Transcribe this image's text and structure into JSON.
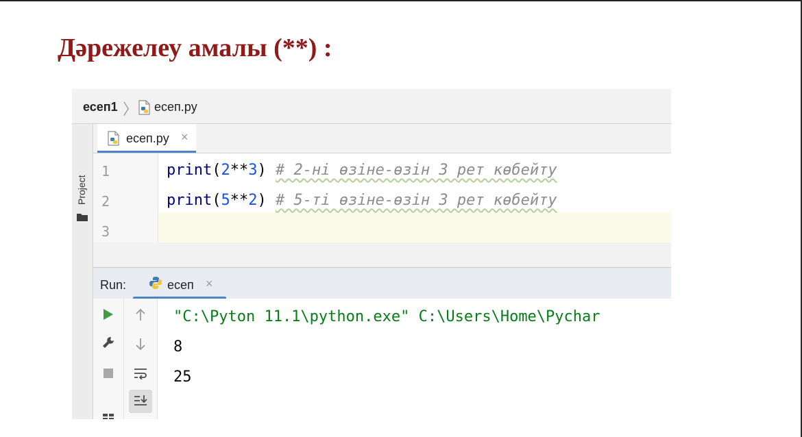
{
  "slide": {
    "title": "Дәрежелеу амалы (**) :"
  },
  "breadcrumb": {
    "project": "есеп1",
    "separator": "〉",
    "file": "есеп.py"
  },
  "sidebar": {
    "project_label": "Project"
  },
  "tabs": [
    {
      "label": "есеп.py",
      "close": "×"
    }
  ],
  "editor": {
    "line_numbers": [
      "1",
      "2",
      "3"
    ],
    "lines": [
      {
        "fn": "print",
        "open": "(",
        "a": "2",
        "op": "**",
        "b": "3",
        "close": ")",
        "comment": "# 2-ні өзіне-өзін 3 рет көбейту"
      },
      {
        "fn": "print",
        "open": "(",
        "a": "5",
        "op": "**",
        "b": "2",
        "close": ")",
        "comment": "# 5-ті өзіне-өзін 3 рет көбейту"
      }
    ]
  },
  "run": {
    "label": "Run:",
    "tab_label": "есеп",
    "tab_close": "×",
    "output": [
      "\"C:\\Pyton 11.1\\python.exe\" C:\\Users\\Home\\Pychar",
      "8",
      "25"
    ]
  },
  "colors": {
    "title": "#8e1a1a",
    "keyword": "#000080",
    "number": "#1750eb",
    "comment": "#8c8c8c",
    "accent": "#4a86c7",
    "run_green": "#3f9d3f"
  }
}
